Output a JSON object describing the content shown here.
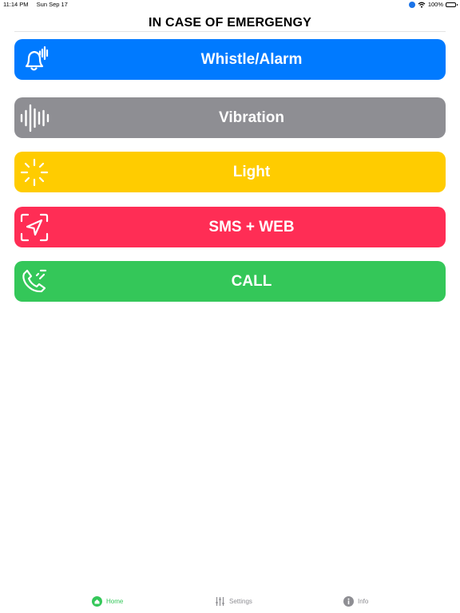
{
  "status_bar": {
    "time": "11:14 PM",
    "date": "Sun Sep 17",
    "battery": "100%"
  },
  "page": {
    "title": "IN CASE OF EMERGENGY"
  },
  "buttons": [
    {
      "label": "Whistle/Alarm",
      "icon": "bell-icon",
      "color": "#007aff"
    },
    {
      "label": "Vibration",
      "icon": "waveform-icon",
      "color": "#8e8e93"
    },
    {
      "label": "Light",
      "icon": "light-burst-icon",
      "color": "#ffcc00"
    },
    {
      "label": "SMS + WEB",
      "icon": "location-arrow-icon",
      "color": "#ff2d55"
    },
    {
      "label": "CALL",
      "icon": "phone-call-icon",
      "color": "#34c759"
    }
  ],
  "tab_bar": {
    "items": [
      {
        "label": "Home",
        "icon": "home-icon",
        "active": true
      },
      {
        "label": "Settings",
        "icon": "sliders-icon",
        "active": false
      },
      {
        "label": "Info",
        "icon": "info-icon",
        "active": false
      }
    ],
    "active_color": "#34c759",
    "inactive_color": "#8e8e93"
  }
}
